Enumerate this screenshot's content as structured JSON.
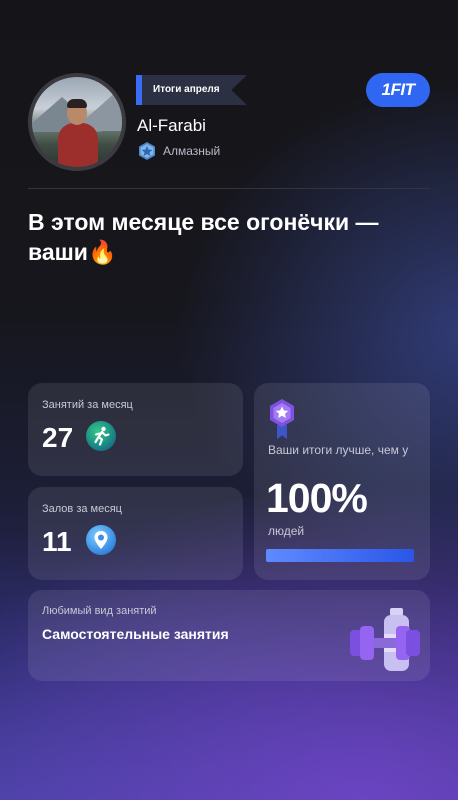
{
  "profile": {
    "period_tag": "Итоги апреля",
    "brand": "1FIT",
    "username": "Al-Farabi",
    "rank": "Алмазный"
  },
  "headline": {
    "line1": "В этом месяце все огонёчки —",
    "line2": "ваши",
    "emoji": "🔥"
  },
  "stats": {
    "workouts": {
      "label": "Занятий за месяц",
      "value": "27",
      "icon": "running-icon"
    },
    "gyms": {
      "label": "Залов за месяц",
      "value": "11",
      "icon": "location-pin-icon"
    }
  },
  "ranking": {
    "lead": "Ваши итоги лучше, чем у",
    "percent": "100%",
    "people": "людей",
    "progress": 1.0,
    "icon": "medal-icon"
  },
  "favorite": {
    "label": "Любимый вид занятий",
    "value": "Самостоятельные занятия",
    "icon": "dumbbell-bottle-icon"
  },
  "colors": {
    "accent": "#2f66f2",
    "progress_fill": "#3b6cf6",
    "rank_badge": "#5aa0e0"
  }
}
